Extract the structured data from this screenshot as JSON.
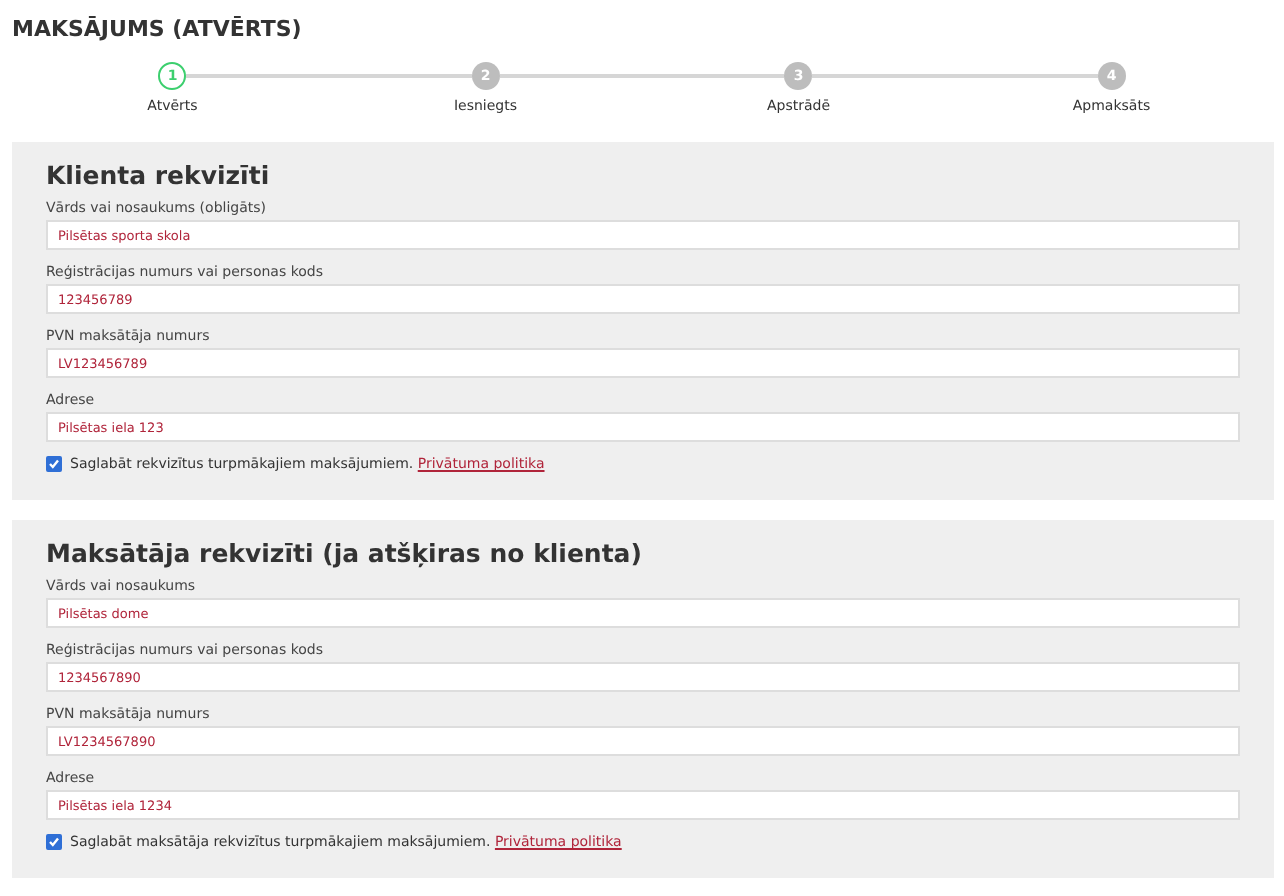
{
  "page": {
    "title": "MAKSĀJUMS (ATVĒRTS)"
  },
  "steps": [
    {
      "number": "1",
      "label": "Atvērts",
      "selected": true
    },
    {
      "number": "2",
      "label": "Iesniegts",
      "selected": false
    },
    {
      "number": "3",
      "label": "Apstrādē",
      "selected": false
    },
    {
      "number": "4",
      "label": "Apmaksāts",
      "selected": false
    }
  ],
  "sections": [
    {
      "heading": "Klienta rekvizīti",
      "fields": [
        {
          "label": "Vārds vai nosaukums (obligāts)",
          "value": "Pilsētas sporta skola"
        },
        {
          "label": "Reģistrācijas numurs vai personas kods",
          "value": "123456789"
        },
        {
          "label": "PVN maksātāja numurs",
          "value": "LV123456789"
        },
        {
          "label": "Adrese",
          "value": "Pilsētas iela 123"
        }
      ],
      "consent": {
        "text": "Saglabāt rekvizītus turpmākajiem maksājumiem.",
        "link": "Privātuma politika",
        "checked": true
      }
    },
    {
      "heading": "Maksātāja rekvizīti (ja atšķiras no klienta)",
      "fields": [
        {
          "label": "Vārds vai nosaukums",
          "value": "Pilsētas dome"
        },
        {
          "label": "Reģistrācijas numurs vai personas kods",
          "value": "1234567890"
        },
        {
          "label": "PVN maksātāja numurs",
          "value": "LV1234567890"
        },
        {
          "label": "Adrese",
          "value": "Pilsētas iela 1234"
        }
      ],
      "consent": {
        "text": "Saglabāt maksātāja rekvizītus turpmākajiem maksājumiem.",
        "link": "Privātuma politika",
        "checked": true
      }
    }
  ]
}
